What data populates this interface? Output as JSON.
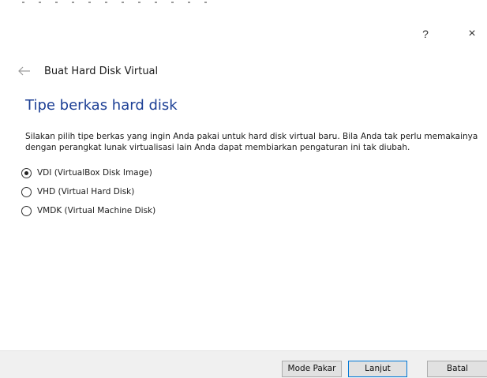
{
  "window": {
    "help_label": "?",
    "close_label": "×"
  },
  "wizard": {
    "back_icon": "arrow-left-icon",
    "title": "Buat Hard Disk Virtual",
    "heading": "Tipe berkas hard disk",
    "description_line1": "Silakan pilih tipe berkas yang ingin Anda pakai untuk hard disk virtual baru. Bila Anda tak perlu memakainya",
    "description_line2": "dengan perangkat lunak virtualisasi lain Anda dapat membiarkan pengaturan ini tak diubah.",
    "options": [
      {
        "label": "VDI (VirtualBox Disk Image)",
        "checked": true
      },
      {
        "label": "VHD (Virtual Hard Disk)",
        "checked": false
      },
      {
        "label": "VMDK (Virtual Machine Disk)",
        "checked": false
      }
    ]
  },
  "footer": {
    "expert_label": "Mode Pakar",
    "next_label": "Lanjut",
    "cancel_label": "Batal"
  },
  "colors": {
    "heading": "#1c3f95",
    "primary_border": "#0078d7",
    "footer_bg": "#f0f0f0"
  }
}
